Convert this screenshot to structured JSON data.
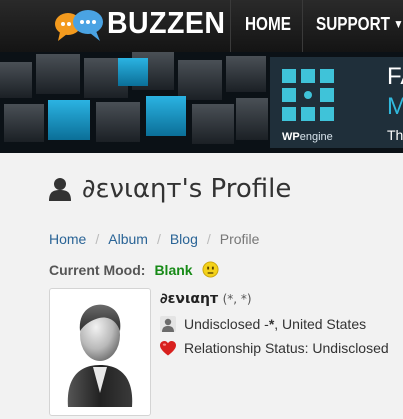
{
  "brand": {
    "logo_text": "BUZZEN"
  },
  "nav": {
    "home": "HOME",
    "support": "SUPPORT"
  },
  "ad": {
    "brand_prefix": "WP",
    "brand_suffix": "engine",
    "line1": "FA",
    "line2": "M",
    "line3": "Th"
  },
  "profile": {
    "title": "∂ενιαηт's Profile",
    "username": "∂ενιαηт",
    "username_meta": "(*, *)",
    "location": "Undisclosed - ",
    "location_bold": "*",
    "location_rest": ", United States",
    "relationship": "Relationship Status: Undisclosed"
  },
  "breadcrumb": [
    "Home",
    "Album",
    "Blog",
    "Profile"
  ],
  "mood": {
    "label": "Current Mood:",
    "value": "Blank"
  },
  "colors": {
    "mood": "#178a17",
    "link": "#2a6496",
    "accent": "#31b9dd"
  },
  "icons": [
    "chat-bubbles-icon",
    "caret-down-icon",
    "user-icon",
    "smiley-icon",
    "person-icon",
    "heart-icon",
    "avatar-placeholder-icon",
    "wpengine-logo-icon"
  ]
}
